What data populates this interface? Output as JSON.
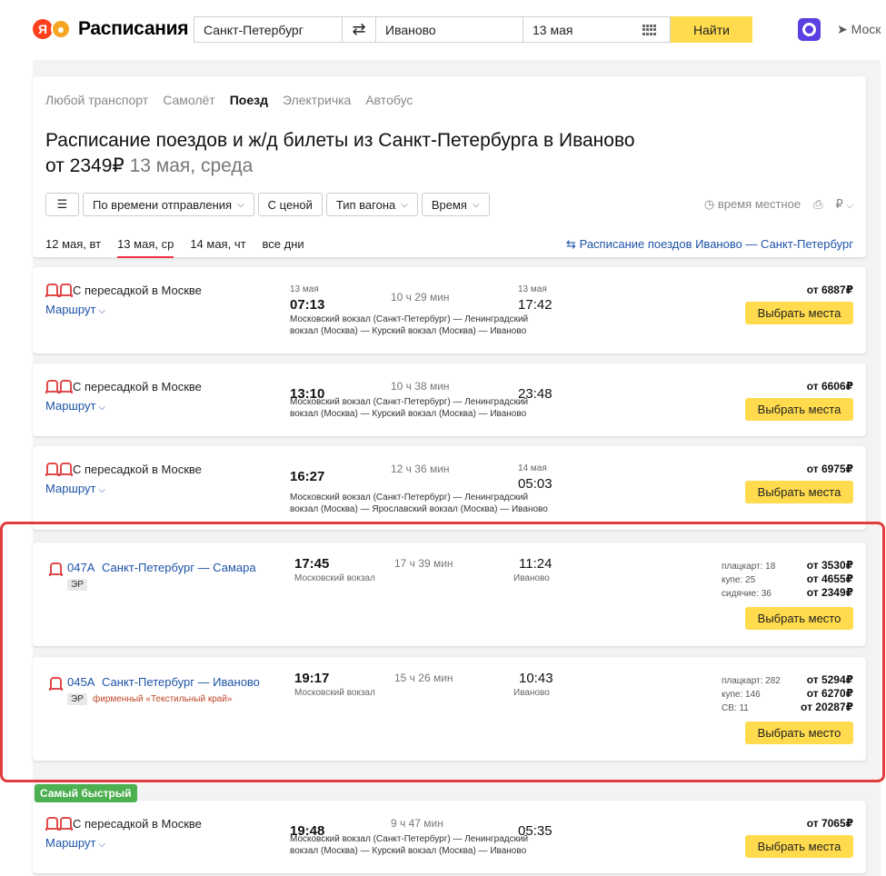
{
  "header": {
    "logo_letter": "Я",
    "logo_text": "Расписания",
    "from": "Санкт-Петербург",
    "to": "Иваново",
    "date": "13 мая",
    "find_label": "Найти",
    "location": "Моск"
  },
  "transport_tabs": [
    "Любой транспорт",
    "Самолёт",
    "Поезд",
    "Электричка",
    "Автобус"
  ],
  "active_transport": "Поезд",
  "title": {
    "main": "Расписание поездов и ж/д билеты из Санкт-Петербурга в Иваново",
    "price_prefix": "от 2349₽",
    "date_suffix": "13 мая, среда"
  },
  "filters": {
    "sort": "По времени отправления",
    "with_price": "С ценой",
    "car_type": "Тип вагона",
    "time": "Время",
    "local_time": "время местное",
    "currency": "₽"
  },
  "day_tabs": [
    "12 мая, вт",
    "13 мая, ср",
    "14 мая, чт",
    "все дни"
  ],
  "reverse_link": "Расписание поездов Иваново — Санкт-Петербург",
  "common": {
    "transfer": "С пересадкой в Москве",
    "route": "Маршрут",
    "choose_places": "Выбрать места",
    "choose_place": "Выбрать место"
  },
  "transfer_trips": [
    {
      "dep_date": "13 мая",
      "dep": "07:13",
      "duration": "10 ч 29 мин",
      "arr_date": "13 мая",
      "arr": "17:42",
      "stations": "Московский вокзал (Санкт-Петербург) — Ленинградский вокзал (Москва) — Курский вокзал (Москва) — Иваново",
      "price": "от 6887₽"
    },
    {
      "dep_date": "",
      "dep": "13:10",
      "duration": "10 ч 38 мин",
      "arr_date": "",
      "arr": "23:48",
      "stations": "Московский вокзал (Санкт-Петербург) — Ленинградский вокзал (Москва) — Курский вокзал (Москва) — Иваново",
      "price": "от 6606₽"
    },
    {
      "dep_date": "",
      "dep": "16:27",
      "duration": "12 ч 36 мин",
      "arr_date": "14 мая",
      "arr": "05:03",
      "stations": "Московский вокзал (Санкт-Петербург) — Ленинградский вокзал (Москва) — Ярославский вокзал (Москва) — Иваново",
      "price": "от 6975₽"
    },
    {
      "dep_date": "",
      "dep": "19:48",
      "duration": "9 ч 47 мин",
      "arr_date": "",
      "arr": "05:35",
      "stations": "Московский вокзал (Санкт-Петербург) — Ленинградский вокзал (Москва) — Курский вокзал (Москва) — Иваново",
      "price": "от 7065₽"
    }
  ],
  "direct_trips": [
    {
      "number": "047А",
      "name": "Санкт-Петербург — Самара",
      "badge": "ЭР",
      "brand": "",
      "dep": "17:45",
      "dep_station": "Московский вокзал",
      "duration": "17 ч 39 мин",
      "arr": "11:24",
      "arr_station": "Иваново",
      "classes": [
        {
          "name": "плацкарт: 18",
          "price": "от 3530₽"
        },
        {
          "name": "купе: 25",
          "price": "от 4655₽"
        },
        {
          "name": "сидячие: 36",
          "price": "от 2349₽"
        }
      ]
    },
    {
      "number": "045А",
      "name": "Санкт-Петербург — Иваново",
      "badge": "ЭР",
      "brand": "фирменный «Текстильный край»",
      "dep": "19:17",
      "dep_station": "Московский вокзал",
      "duration": "15 ч 26 мин",
      "arr": "10:43",
      "arr_station": "Иваново",
      "classes": [
        {
          "name": "плацкарт: 282",
          "price": "от 5294₽"
        },
        {
          "name": "купе: 146",
          "price": "от 6270₽"
        },
        {
          "name": "СВ: 11",
          "price": "от 20287₽"
        }
      ]
    }
  ],
  "fastest_label": "Самый быстрый"
}
